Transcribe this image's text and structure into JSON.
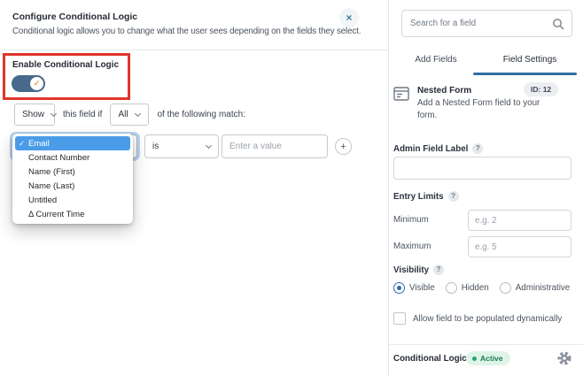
{
  "icons": {
    "close": "×",
    "check": "✓",
    "plus": "+",
    "help": "?"
  },
  "modal": {
    "title": "Configure Conditional Logic",
    "description": "Conditional logic allows you to change what the user sees depending on the fields they select.",
    "enable_toggle": {
      "label": "Enable Conditional Logic",
      "enabled": true
    },
    "logic_sentence": {
      "action_value": "Show",
      "middle_text": "this field if",
      "match_value": "All",
      "end_text": "of the following match:"
    },
    "condition_row": {
      "operator_value": "is",
      "value_placeholder": "Enter a value"
    },
    "field_dropdown": {
      "selected": "Email",
      "options": [
        {
          "label": "Email"
        },
        {
          "label": "Contact Number"
        },
        {
          "label": "Name (First)"
        },
        {
          "label": "Name (Last)"
        },
        {
          "label": "Untitled"
        },
        {
          "label": "Δ Current Time"
        }
      ]
    }
  },
  "sidebar": {
    "search": {
      "placeholder": "Search for a field"
    },
    "tabs": [
      {
        "label": "Add Fields",
        "active": false
      },
      {
        "label": "Field Settings",
        "active": true
      }
    ],
    "field_info": {
      "name": "Nested Form",
      "id_badge": "ID: 12",
      "description": "Add a Nested Form field to your form."
    },
    "settings": {
      "admin_field_label": "Admin Field Label",
      "entry_limits_label": "Entry Limits",
      "minimum_label": "Minimum",
      "minimum_placeholder": "e.g. 2",
      "maximum_label": "Maximum",
      "maximum_placeholder": "e.g. 5",
      "visibility_label": "Visibility",
      "visibility_options": [
        {
          "label": "Visible",
          "selected": true
        },
        {
          "label": "Hidden",
          "selected": false
        },
        {
          "label": "Administrative",
          "selected": false
        }
      ],
      "dynamic_population_label": "Allow field to be populated dynamically"
    },
    "footer": {
      "conditional_logic_label": "Conditional Logic",
      "status_badge": "Active"
    }
  },
  "colors": {
    "accent_blue": "#2f6fa3",
    "toggle_blue": "#47698c",
    "selection_blue": "#4b9ce8",
    "highlight_red": "#e0352b",
    "active_green_text": "#187a50",
    "active_green_bg": "#def4e8"
  }
}
